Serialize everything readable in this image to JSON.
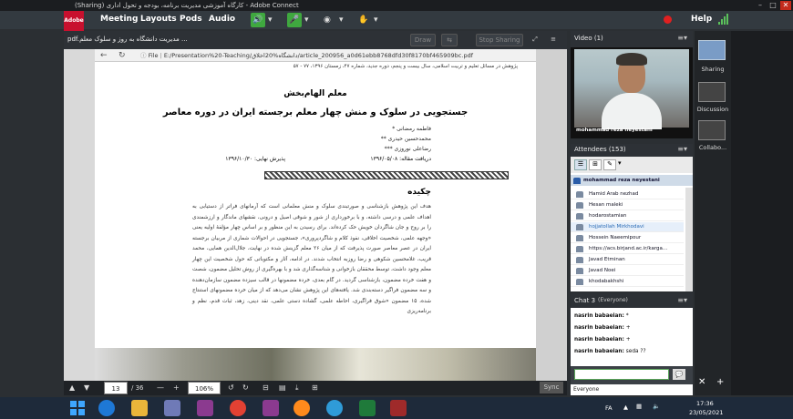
{
  "window": {
    "title": "(Sharing) کارگاه آموزشی مدیریت برنامه، بودجه و تحول اداری - Adobe Connect",
    "logo_label": "Adobe"
  },
  "menu": {
    "items": [
      "Meeting",
      "Layouts",
      "Pods",
      "Audio"
    ],
    "help_label": "Help"
  },
  "share_pod": {
    "title": "pdf.مدیریت دانشگاه به روز و سلوک معلم ...",
    "buttons": [
      "Draw",
      "Stop Sharing"
    ]
  },
  "browser": {
    "file_label": "File",
    "address": "E:/Presentation%20-Teaching/دانشگاه%20اخلاق/article_200956_a0d61ebb8768dfd30f8170bf465909bc.pdf"
  },
  "pdf": {
    "header": "پژوهش در مسائل تعلیم و تربیت اسلامی، سال بیست و پنجم، دوره جدید، شماره ۴۷، زمستان ۱۳۹۶، ۷۷ - ۵۷",
    "title1": "معلم الهام‌بخش",
    "title2": "جستجویی در سلوک و منش چهار معلم برجسته ایران در دوره معاصر",
    "authors": [
      "فاطمه رمضانی *",
      "محمدحسین حیدری **",
      "رضاعلی نوروزی ***"
    ],
    "received": "دریافت مقاله: ۱۳۹۶/۰۵/۰۸",
    "accepted": "پذیرش نهایی: ۱۳۹۶/۱۰/۳۰",
    "abstract_heading": "چکیده",
    "abstract_text": "هدف این پژوهش بازشناسی و صورتبندی سلوک و منش معلمانی است که آرمانهای فراتر از دستیابی به اهداف علمی و درسی داشته، و با برخورداری از شور و شوقی اصیل و درونی، نقشهای ماندگار و ارزشمندی را بر روح و جان شاگردان خویش حک کرده‌اند. برای رسیدن به این منظور و بر اساس چهار مؤلفهٔ اولیه یعنی «وجهه علمی، شخصیت اخلاقی، نفوذ کلام و شاگردپروری»، جستجویی در احوالات شماری از مربیان برجسته ایران در عصر معاصر صورت پذیرفت که از میان ۲۶ معلم گزینش شده در نهایت، جلال‌الدین همایی، محمد قریب، غلامحسین شکوهی و رضا روزبه انتخاب شدند. در ادامه، آثار و مکتوباتی که حول شخصیت این چهار معلم وجود داشت، توسط محققان بازخوانی و شناسه‌گذاری شد و با بهره‌گیری از روش تحلیل مضمون، شصت و هفت خرده مضمون، بازشناسی گردید. در گام بعدی، خرده مضمونها در قالب سیزده مضمون سازمان‌دهنده و سه مضمون فراگیر دسته‌بندی شد. یافته‌های این پژوهش نشان می‌دهد که از میان خرده مضمونهای استنتاج شده، ۱۵ مضمون «شوق فراگیری، احاطه علمی، گشاده دستی علمی، نقد دینی، زهد، ثبات قدم، نظم و برنامه‌ریزی"
  },
  "share_footer": {
    "page_current": "13",
    "page_total": "/ 36",
    "zoom": "106%",
    "sync_label": "Sync"
  },
  "video_pod": {
    "title": "Video (1)",
    "presenter_name": "mohammad reza neyestani"
  },
  "attendees_pod": {
    "title": "Attendees (153)",
    "host": "mohammad reza neyestani",
    "list": [
      {
        "name": "Hamid Arab nezhad",
        "selected": false
      },
      {
        "name": "Hesan maleki",
        "selected": false
      },
      {
        "name": "hodarostamian",
        "selected": false
      },
      {
        "name": "hojjatollah Mirkhodavi",
        "selected": true
      },
      {
        "name": "Hossein Naeemipour",
        "selected": false
      },
      {
        "name": "https://acs.birjand.ac.ir/karga...",
        "selected": false
      },
      {
        "name": "Javad Etminan",
        "selected": false
      },
      {
        "name": "Javad Noei",
        "selected": false
      },
      {
        "name": "khodabakhshi",
        "selected": false
      }
    ]
  },
  "chat_pod": {
    "title": "Chat 3",
    "audience": "(Everyone)",
    "messages": [
      {
        "sender": "nasrin babaeian:",
        "text": "*"
      },
      {
        "sender": "nasrin babaeian:",
        "text": "+"
      },
      {
        "sender": "nasrin babaeian:",
        "text": "+"
      },
      {
        "sender": "nasrin babaeian:",
        "text": "seda ??"
      }
    ],
    "tab_label": "Everyone"
  },
  "layouts_panel": {
    "items": [
      "Sharing",
      "Discussion",
      "Collabo..."
    ]
  },
  "taskbar": {
    "lang": "FA",
    "time": "17:36",
    "date": "23/05/2021"
  },
  "colors": {
    "accent": "#7a9cc6",
    "mic_on": "#3fa83f",
    "record": "#e02020"
  }
}
